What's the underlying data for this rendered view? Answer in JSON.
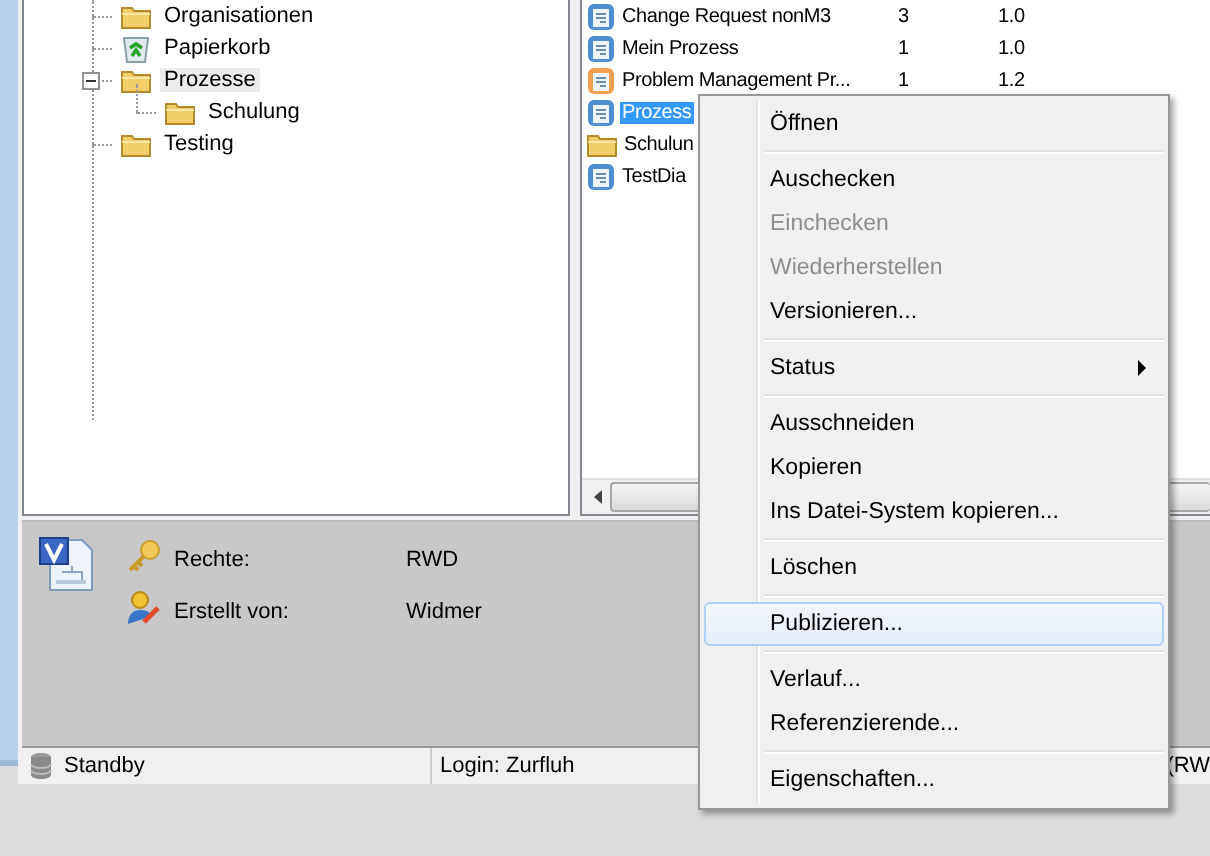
{
  "tree": [
    {
      "label": "Organisationen",
      "kind": "folder",
      "selected": false
    },
    {
      "label": "Papierkorb",
      "kind": "recycle-bin",
      "selected": false
    },
    {
      "label": "Prozesse",
      "kind": "folder",
      "selected": true,
      "expanded": true,
      "children": [
        {
          "label": "Schulung",
          "kind": "folder",
          "selected": false
        }
      ]
    },
    {
      "label": "Testing",
      "kind": "folder",
      "selected": false
    }
  ],
  "list": {
    "rows": [
      {
        "kind": "process",
        "name": "Change Request nonM3",
        "count": "3",
        "version": "1.0",
        "selected": false
      },
      {
        "kind": "process",
        "name": "Mein Prozess",
        "count": "1",
        "version": "1.0",
        "selected": false
      },
      {
        "kind": "process-alt",
        "name": "Problem Management Pr...",
        "count": "1",
        "version": "1.2",
        "selected": false
      },
      {
        "kind": "process",
        "name": "Prozess",
        "selected": true
      },
      {
        "kind": "folder",
        "name": "Schulun",
        "selected": false
      },
      {
        "kind": "process",
        "name": "TestDia",
        "selected": false
      }
    ]
  },
  "details": [
    {
      "kind": "key",
      "label": "Rechte:",
      "value": "RWD"
    },
    {
      "kind": "author",
      "label": "Erstellt von:",
      "value": "Widmer"
    }
  ],
  "status_bar": {
    "state": "Standby",
    "login": "Login: Zurfluh",
    "rights": "(RW"
  },
  "context_menu": [
    {
      "kind": "item",
      "label": "Öffnen",
      "disabled": false,
      "selected": false
    },
    {
      "kind": "separator"
    },
    {
      "kind": "item",
      "label": "Auschecken",
      "disabled": false,
      "selected": false
    },
    {
      "kind": "item",
      "label": "Einchecken",
      "disabled": true,
      "selected": false
    },
    {
      "kind": "item",
      "label": "Wiederherstellen",
      "disabled": true,
      "selected": false
    },
    {
      "kind": "item",
      "label": "Versionieren...",
      "disabled": false,
      "selected": false
    },
    {
      "kind": "separator"
    },
    {
      "kind": "submenu",
      "label": "Status",
      "disabled": false,
      "selected": false
    },
    {
      "kind": "separator"
    },
    {
      "kind": "item",
      "label": "Ausschneiden",
      "disabled": false,
      "selected": false
    },
    {
      "kind": "item",
      "label": "Kopieren",
      "disabled": false,
      "selected": false
    },
    {
      "kind": "item",
      "label": "Ins Datei-System kopieren...",
      "disabled": false,
      "selected": false
    },
    {
      "kind": "separator"
    },
    {
      "kind": "item",
      "label": "Löschen",
      "disabled": false,
      "selected": false
    },
    {
      "kind": "separator"
    },
    {
      "kind": "item",
      "label": "Publizieren...",
      "disabled": false,
      "selected": true
    },
    {
      "kind": "separator"
    },
    {
      "kind": "item",
      "label": "Verlauf...",
      "disabled": false,
      "selected": false
    },
    {
      "kind": "item",
      "label": "Referenzierende...",
      "disabled": false,
      "selected": false
    },
    {
      "kind": "separator"
    },
    {
      "kind": "item",
      "label": "Eigenschaften...",
      "disabled": false,
      "selected": false
    }
  ]
}
